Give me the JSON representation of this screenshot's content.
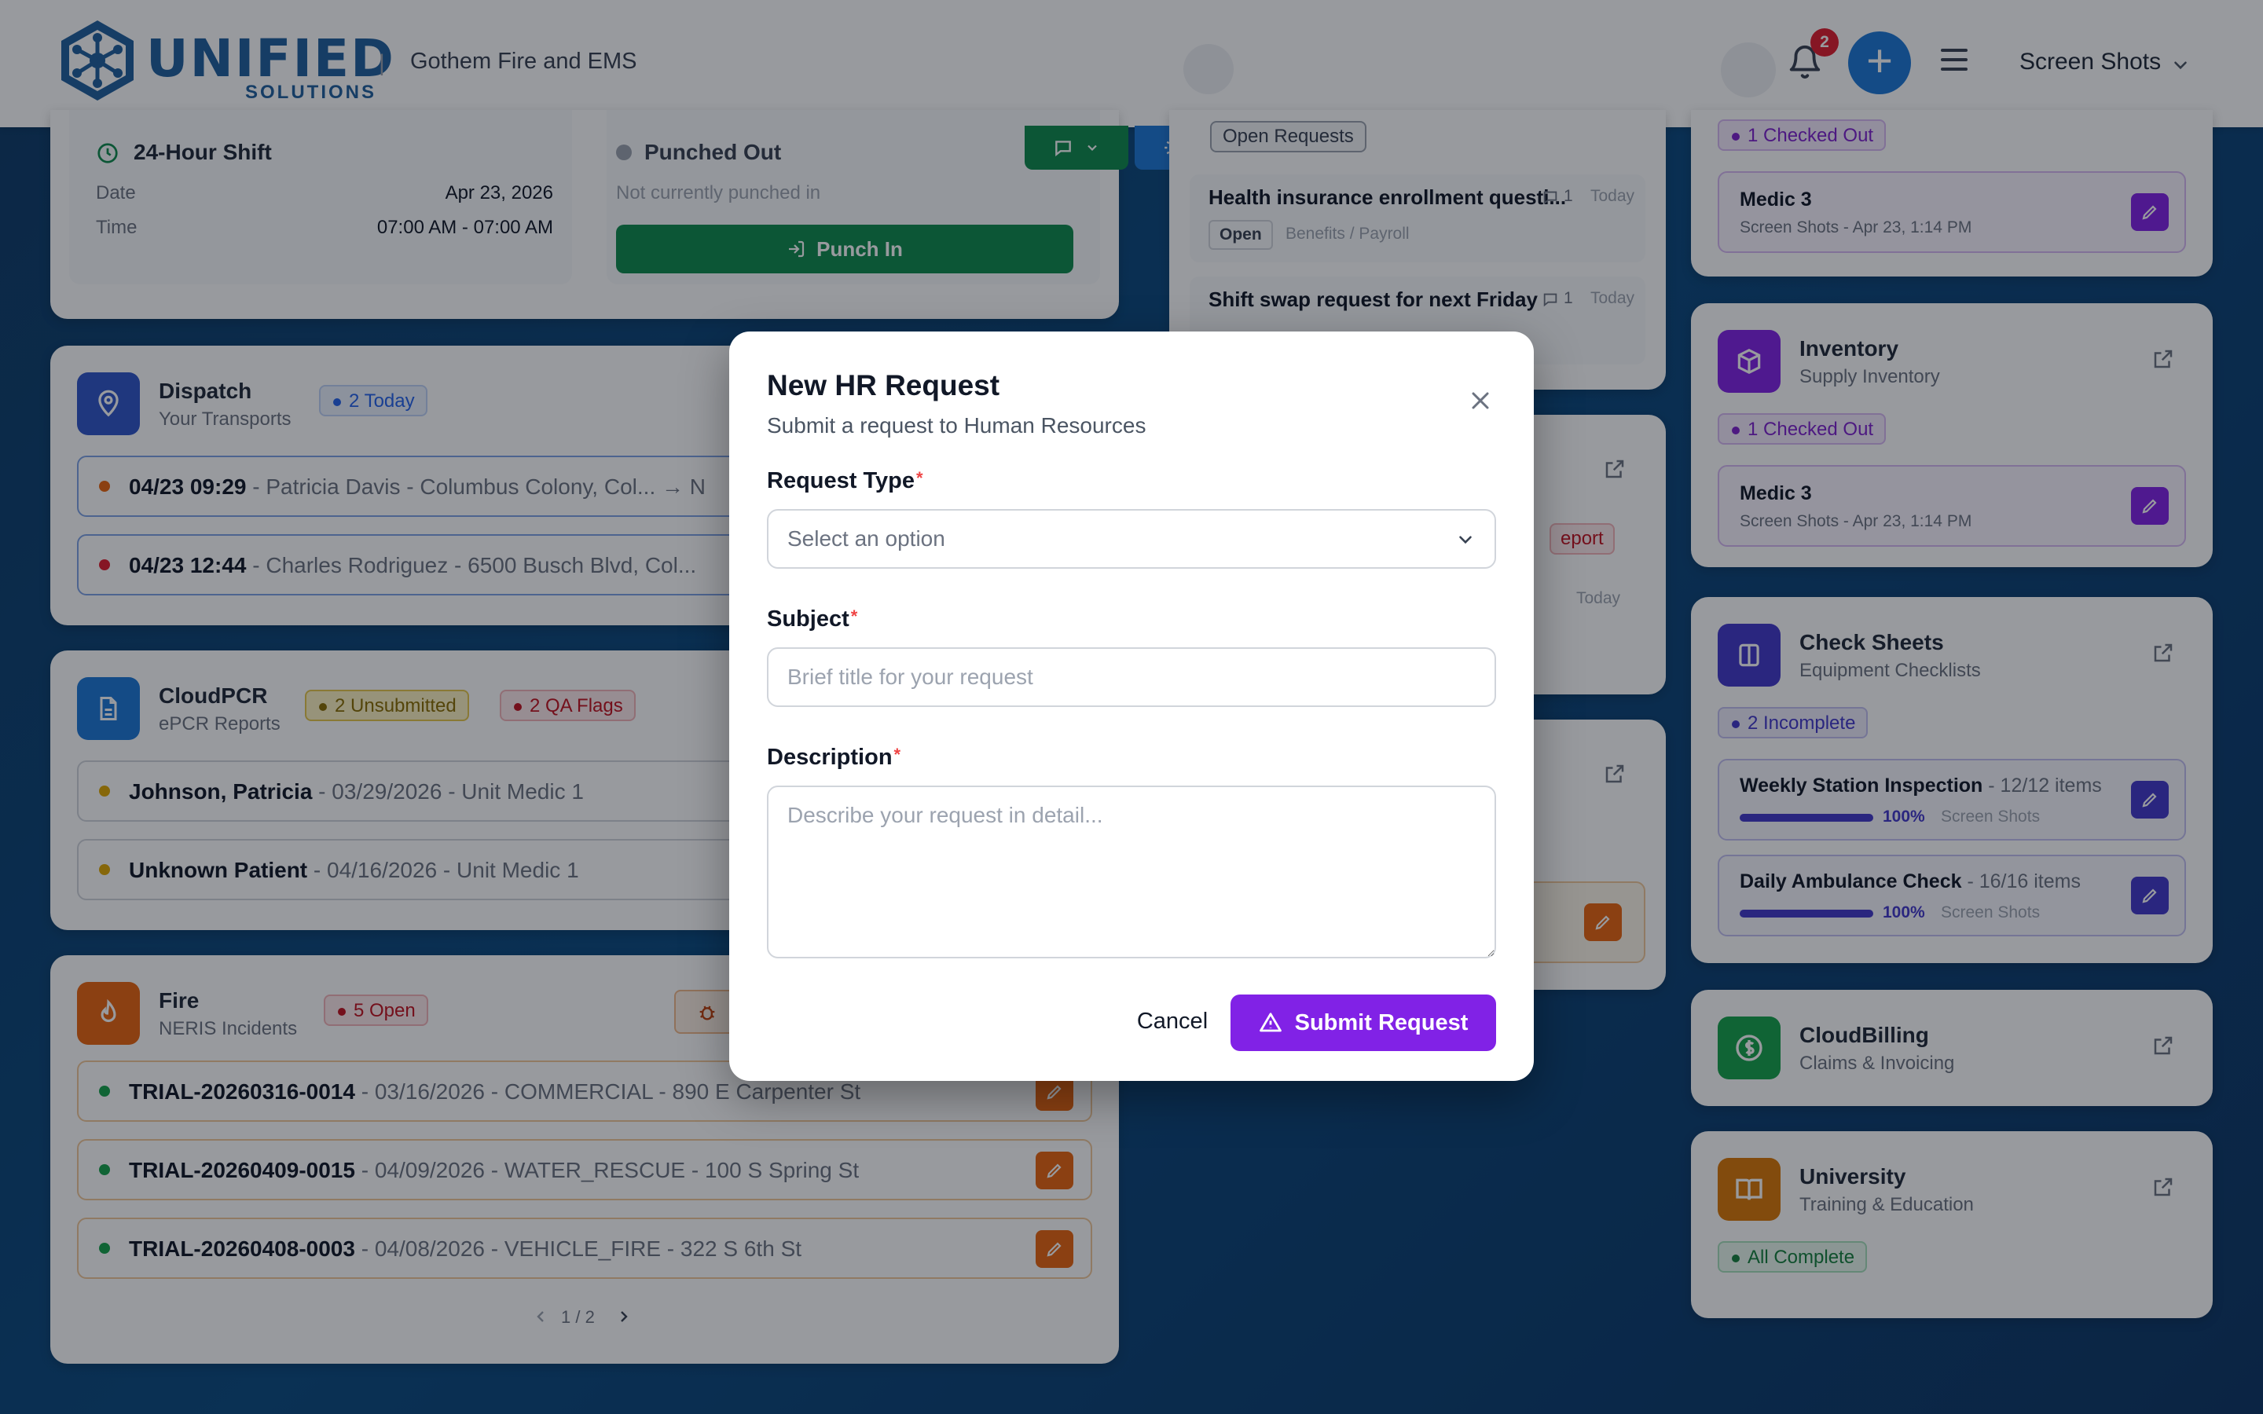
{
  "header": {
    "logo_word": "UNIFIED",
    "logo_sub": "SOLUTIONS",
    "separator": "|",
    "org_name": "Gothem Fire and EMS",
    "notification_count": "2",
    "user_name": "Screen Shots"
  },
  "shift_card": {
    "title": "24-Hour Shift",
    "date_label": "Date",
    "date_value": "Apr 23, 2026",
    "time_label": "Time",
    "time_value": "07:00 AM - 07:00 AM",
    "punch_status": "Punched Out",
    "punch_sub": "Not currently punched in",
    "punch_button": "Punch In"
  },
  "dispatch": {
    "title": "Dispatch",
    "subtitle": "Your Transports",
    "badge": "2 Today",
    "rows": [
      {
        "bold": "04/23 09:29",
        "rest": " - Patricia Davis - Columbus Colony, Col... → N"
      },
      {
        "bold": "04/23 12:44",
        "rest": " - Charles Rodriguez - 6500 Busch Blvd, Col..."
      }
    ]
  },
  "cloudpcr": {
    "title": "CloudPCR",
    "subtitle": "ePCR Reports",
    "badge_unsubmitted": "2 Unsubmitted",
    "badge_qa": "2 QA Flags",
    "rows": [
      {
        "bold": "Johnson, Patricia",
        "rest": " - 03/29/2026 - Unit Medic 1"
      },
      {
        "bold": "Unknown Patient",
        "rest": " - 04/16/2026 - Unit Medic 1"
      }
    ]
  },
  "fire": {
    "title": "Fire",
    "subtitle": "NERIS Incidents",
    "badge": "5 Open",
    "rows": [
      {
        "bold": "TRIAL-20260316-0014",
        "rest": " - 03/16/2026 - COMMERCIAL - 890 E Carpenter St"
      },
      {
        "bold": "TRIAL-20260409-0015",
        "rest": " - 04/09/2026 - WATER_RESCUE - 100 S Spring St"
      },
      {
        "bold": "TRIAL-20260408-0003",
        "rest": " - 04/08/2026 - VEHICLE_FIRE - 322 S 6th St"
      }
    ],
    "pagination": "1 / 2"
  },
  "hr": {
    "tab_label": "Open Requests",
    "requests": [
      {
        "title": "Health insurance enrollment questi...",
        "comments": "1",
        "when": "Today",
        "status": "Open",
        "category": "Benefits / Payroll"
      },
      {
        "title": "Shift swap request for next Friday",
        "comments": "1",
        "when": "Today"
      }
    ],
    "peek_badge": "eport",
    "peek_time": "Today"
  },
  "right_col": {
    "top_badge": "1 Checked Out",
    "top_item": {
      "title": "Medic 3",
      "sub": "Screen Shots - Apr 23, 1:14 PM"
    },
    "inventory": {
      "title": "Inventory",
      "subtitle": "Supply Inventory",
      "badge": "1 Checked Out",
      "item_title": "Medic 3",
      "item_sub": "Screen Shots - Apr 23, 1:14 PM"
    },
    "check_sheets": {
      "title": "Check Sheets",
      "subtitle": "Equipment Checklists",
      "badge": "2 Incomplete",
      "items": [
        {
          "title": "Weekly Station Inspection",
          "count": " - 12/12 items",
          "percent": "100%",
          "progress": 1.0,
          "owner": "Screen Shots"
        },
        {
          "title": "Daily Ambulance Check",
          "count": " - 16/16 items",
          "percent": "100%",
          "progress": 1.0,
          "owner": "Screen Shots"
        }
      ]
    },
    "billing": {
      "title": "CloudBilling",
      "subtitle": "Claims & Invoicing"
    },
    "university": {
      "title": "University",
      "subtitle": "Training & Education",
      "badge": "All Complete"
    }
  },
  "modal": {
    "title": "New HR Request",
    "subtitle": "Submit a request to Human Resources",
    "request_type_label": "Request Type",
    "request_type_placeholder": "Select an option",
    "subject_label": "Subject",
    "subject_placeholder": "Brief title for your request",
    "description_label": "Description",
    "description_placeholder": "Describe your request in detail...",
    "required_mark": "*",
    "cancel": "Cancel",
    "submit": "Submit Request"
  },
  "colors": {
    "accent_purple": "#8122e6",
    "primary_blue": "#1d78d6",
    "success_green": "#0f8a4c",
    "fire_orange": "#e8650e"
  }
}
